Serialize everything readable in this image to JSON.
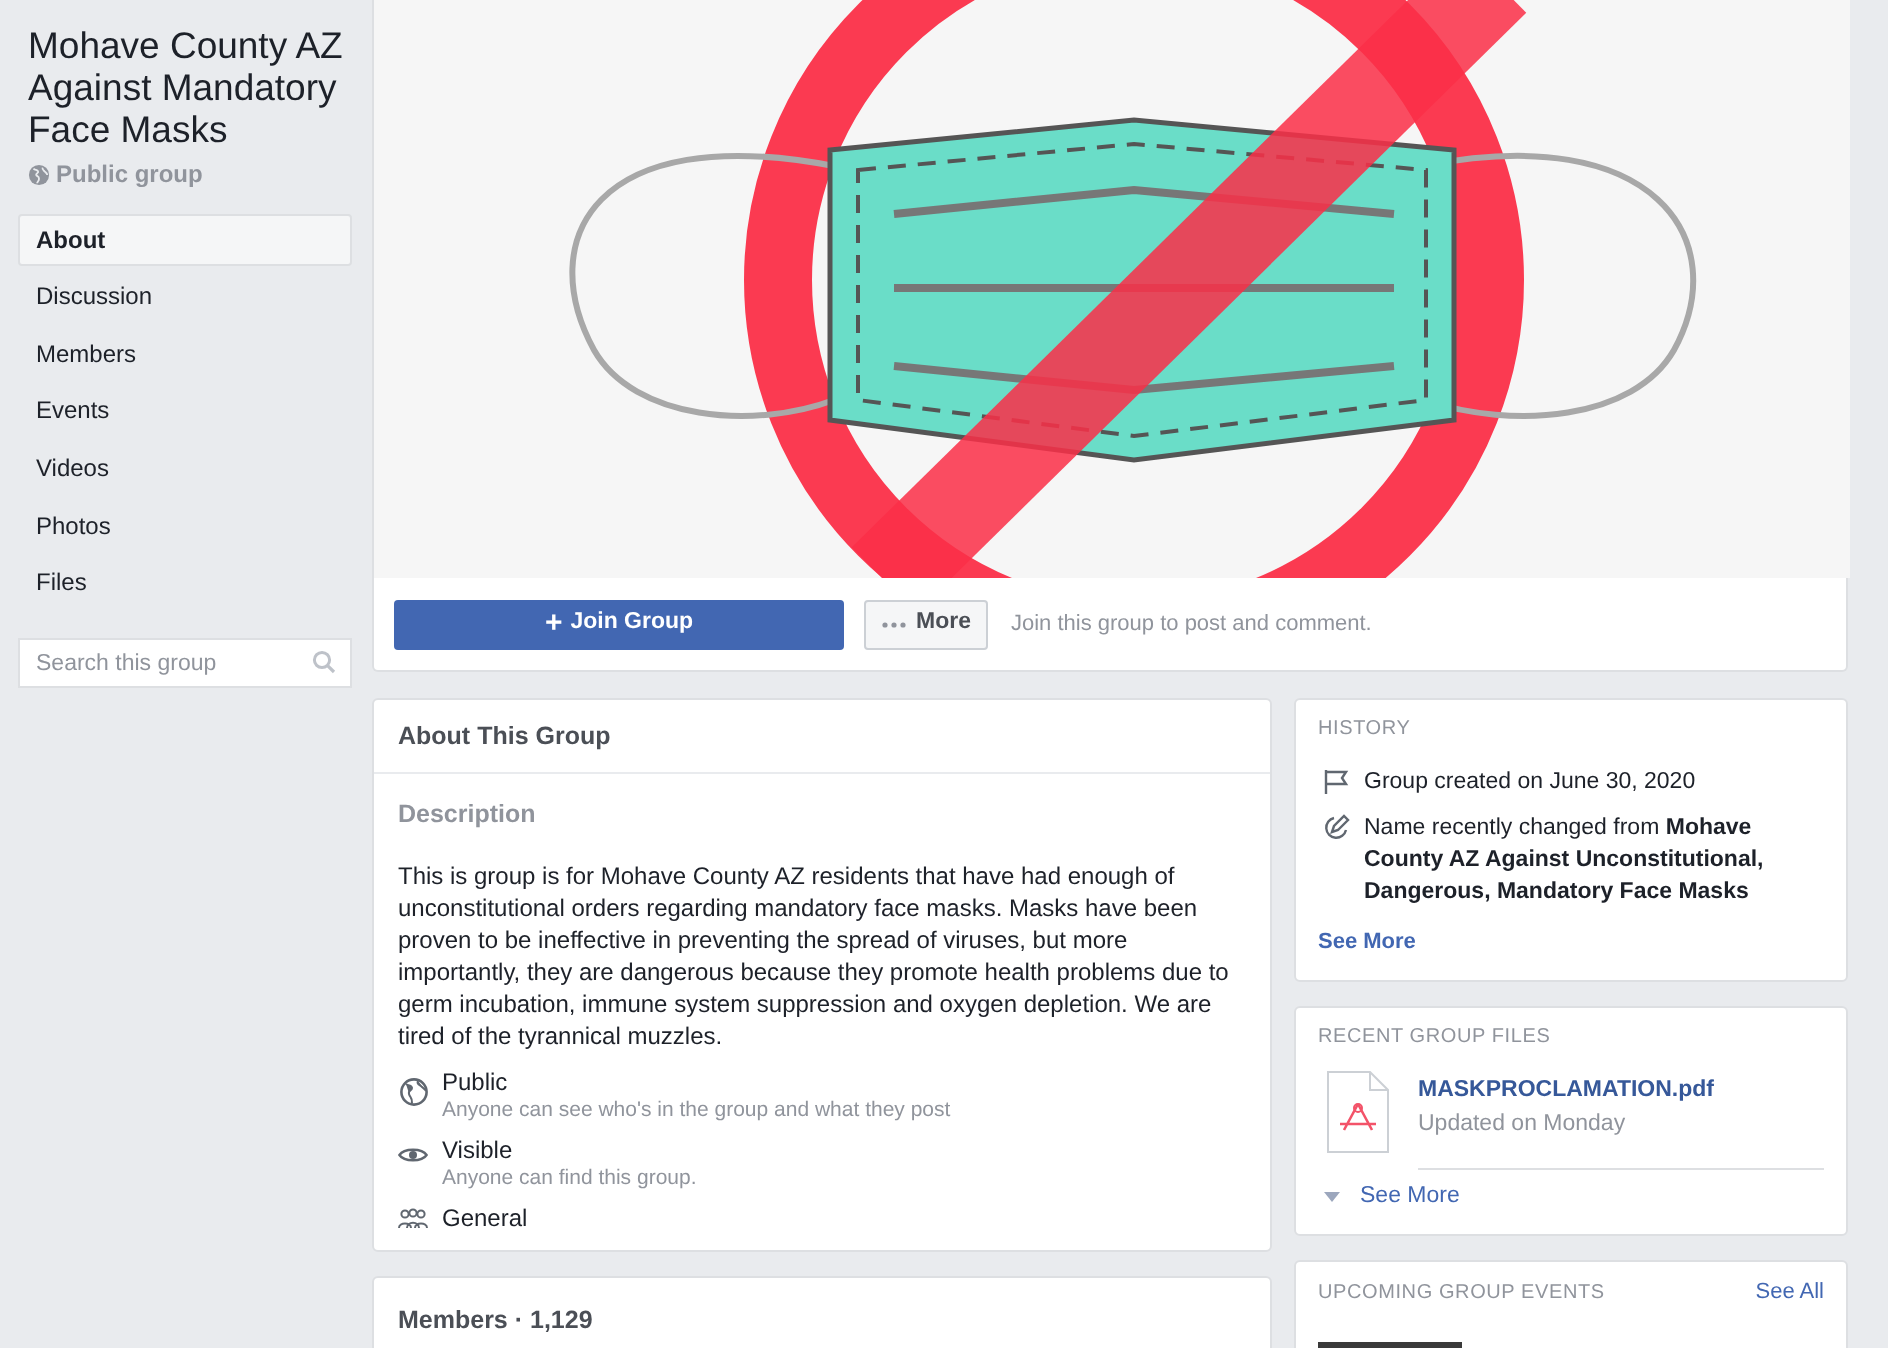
{
  "group": {
    "name": "Mohave County AZ Against Mandatory Face Masks",
    "privacy": "Public group"
  },
  "nav": [
    {
      "label": "About",
      "selected": true
    },
    {
      "label": "Discussion",
      "selected": false
    },
    {
      "label": "Members",
      "selected": false
    },
    {
      "label": "Events",
      "selected": false
    },
    {
      "label": "Videos",
      "selected": false
    },
    {
      "label": "Photos",
      "selected": false
    },
    {
      "label": "Files",
      "selected": false
    }
  ],
  "search": {
    "placeholder": "Search this group"
  },
  "actions": {
    "join": "Join Group",
    "join_icon": "+",
    "more": "More",
    "hint": "Join this group to post and comment."
  },
  "about": {
    "title": "About This Group",
    "description_heading": "Description",
    "description": "This is group is for Mohave County AZ residents that have had enough of unconstitutional orders regarding mandatory face masks. Masks  have been proven to be ineffective in preventing the spread of viruses, but more importantly, they are dangerous because they promote health problems due to germ incubation, immune system suppression and oxygen depletion. We are tired of the tyrannical muzzles.",
    "facts": [
      {
        "kind": "globe",
        "title": "Public",
        "detail": "Anyone can see who's in the group and what they post"
      },
      {
        "kind": "eye",
        "title": "Visible",
        "detail": "Anyone can find this group."
      },
      {
        "kind": "people",
        "title": "General"
      }
    ]
  },
  "members": {
    "title": "Members · 1,129"
  },
  "history": {
    "title": "HISTORY",
    "items": [
      {
        "kind": "flag",
        "text": "Group created on June 30, 2020"
      },
      {
        "kind": "pencil",
        "text": "Name recently changed from **Mohave County AZ Against Unconstitutional, Dangerous, Mandatory Face Masks**"
      }
    ],
    "see_more": "See More"
  },
  "files": {
    "title": "RECENT GROUP FILES",
    "items": [
      {
        "name": "MASKPROCLAMATION.pdf",
        "updated": "Updated on Monday"
      }
    ],
    "see_more": "See More"
  },
  "events": {
    "title": "UPCOMING GROUP EVENTS",
    "see_all": "See All"
  }
}
